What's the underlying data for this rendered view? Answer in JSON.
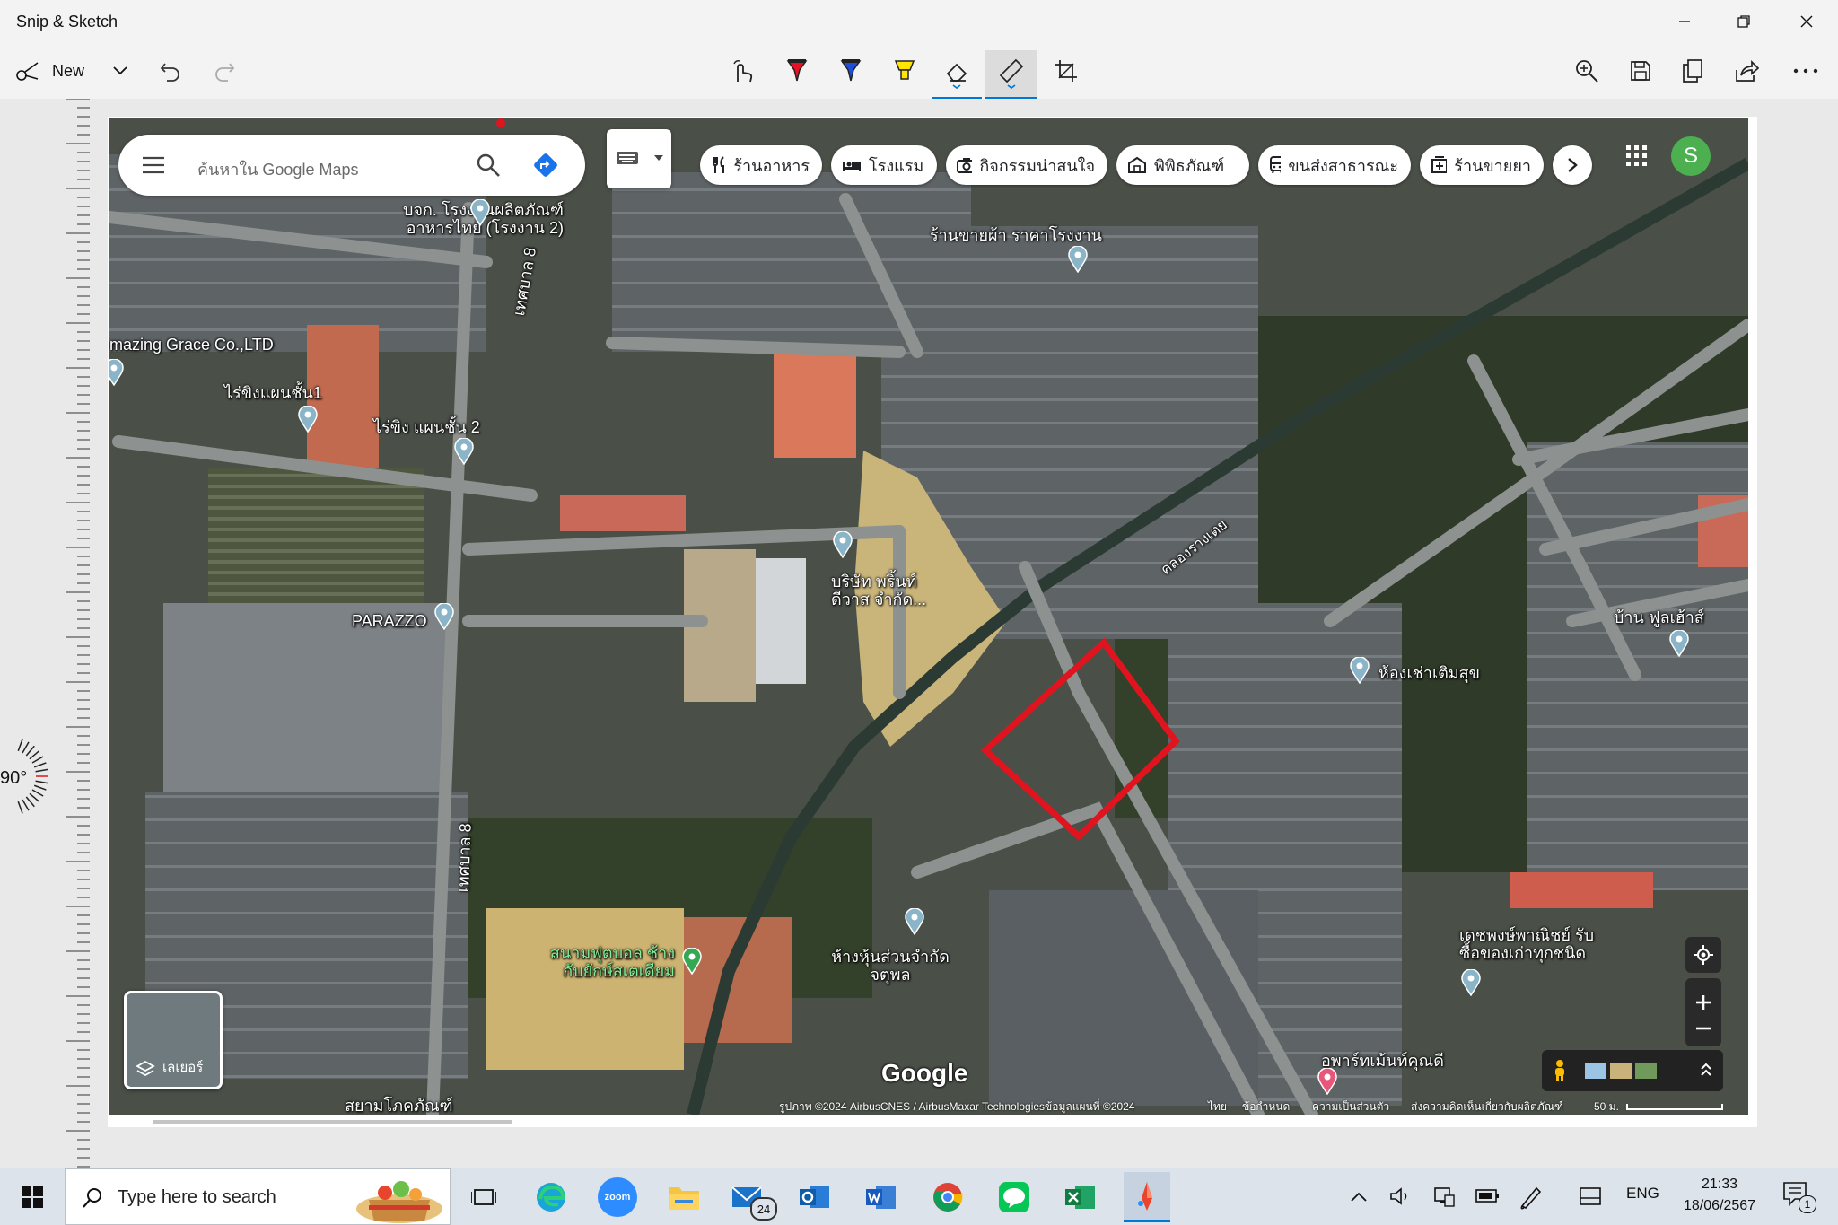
{
  "window": {
    "title": "Snip & Sketch"
  },
  "toolbar": {
    "new_label": "New",
    "tools": [
      "touch-writing",
      "ballpoint-pen",
      "pencil",
      "highlighter",
      "eraser",
      "ruler",
      "crop"
    ],
    "right_tools": [
      "zoom",
      "save",
      "copy",
      "share",
      "more"
    ]
  },
  "protractor": {
    "angle_label": "90°"
  },
  "map": {
    "search_placeholder": "ค้นหาใน Google Maps",
    "chips": [
      "ร้านอาหาร",
      "โรงแรม",
      "กิจกรรมน่าสนใจ",
      "พิพิธภัณฑ์",
      "ขนส่งสาธารณะ",
      "ร้านขายยา"
    ],
    "account_initial": "S",
    "labels": {
      "l1a": "บจก. โรงงานผลิตภัณฑ์",
      "l1b": "อาหารไทย (โรงงาน 2)",
      "road_top": "เทศบาล 8",
      "road_bottom": "เทศบาล 8",
      "amazing": "mazing Grace Co.,LTD",
      "rai1": "ไร่ขิงแผนชั้น1",
      "rai2": "ไร่ขิง แผนชั้น 2",
      "fabric": "ร้านขายผ้า ราคาโรงงาน",
      "print_a": "บริษัท พริ้นท์",
      "print_b": "ดีวาส จำกัด...",
      "parazzo": "PARAZZO",
      "canal": "คลองรางเตย",
      "rental": "ห้องเช่าเติมสุข",
      "house": "บ้าน ฟูลเฮ้าส์",
      "football_a": "สนามฟุตบอล ช้าง",
      "football_b": "กับยักษ์สเตเดียม",
      "partnership_a": "ห้างหุ้นส่วนจำกัด",
      "partnership_b": "จตุพล",
      "dech_a": "เดชพงษ์พาณิชย์ รับ",
      "dech_b": "ซื้อของเก่าทุกชนิด",
      "apartment": "อพาร์ทเม้นท์คุณดี",
      "siam": "สยามโภคภัณฑ์",
      "layers": "เลเยอร์",
      "logo": "Google"
    },
    "attribution": {
      "imagery": "รูปภาพ ©2024 AirbusCNES / AirbusMaxar Technologiesข้อมูลแผนที่ ©2024",
      "lang": "ไทย",
      "terms": "ข้อกำหนด",
      "privacy": "ความเป็นส่วนตัว",
      "feedback": "ส่งความคิดเห็นเกี่ยวกับผลิตภัณฑ์",
      "scale": "50 ม."
    }
  },
  "taskbar": {
    "search_placeholder": "Type here to search",
    "mail_badge": "24",
    "zoom_label": "zoom",
    "lang": "ENG",
    "time": "21:33",
    "date": "18/06/2567",
    "notif_count": "1"
  },
  "colors": {
    "boundary": "#e0141e",
    "accent": "#0078d4",
    "pin": "#8ab4c8"
  }
}
